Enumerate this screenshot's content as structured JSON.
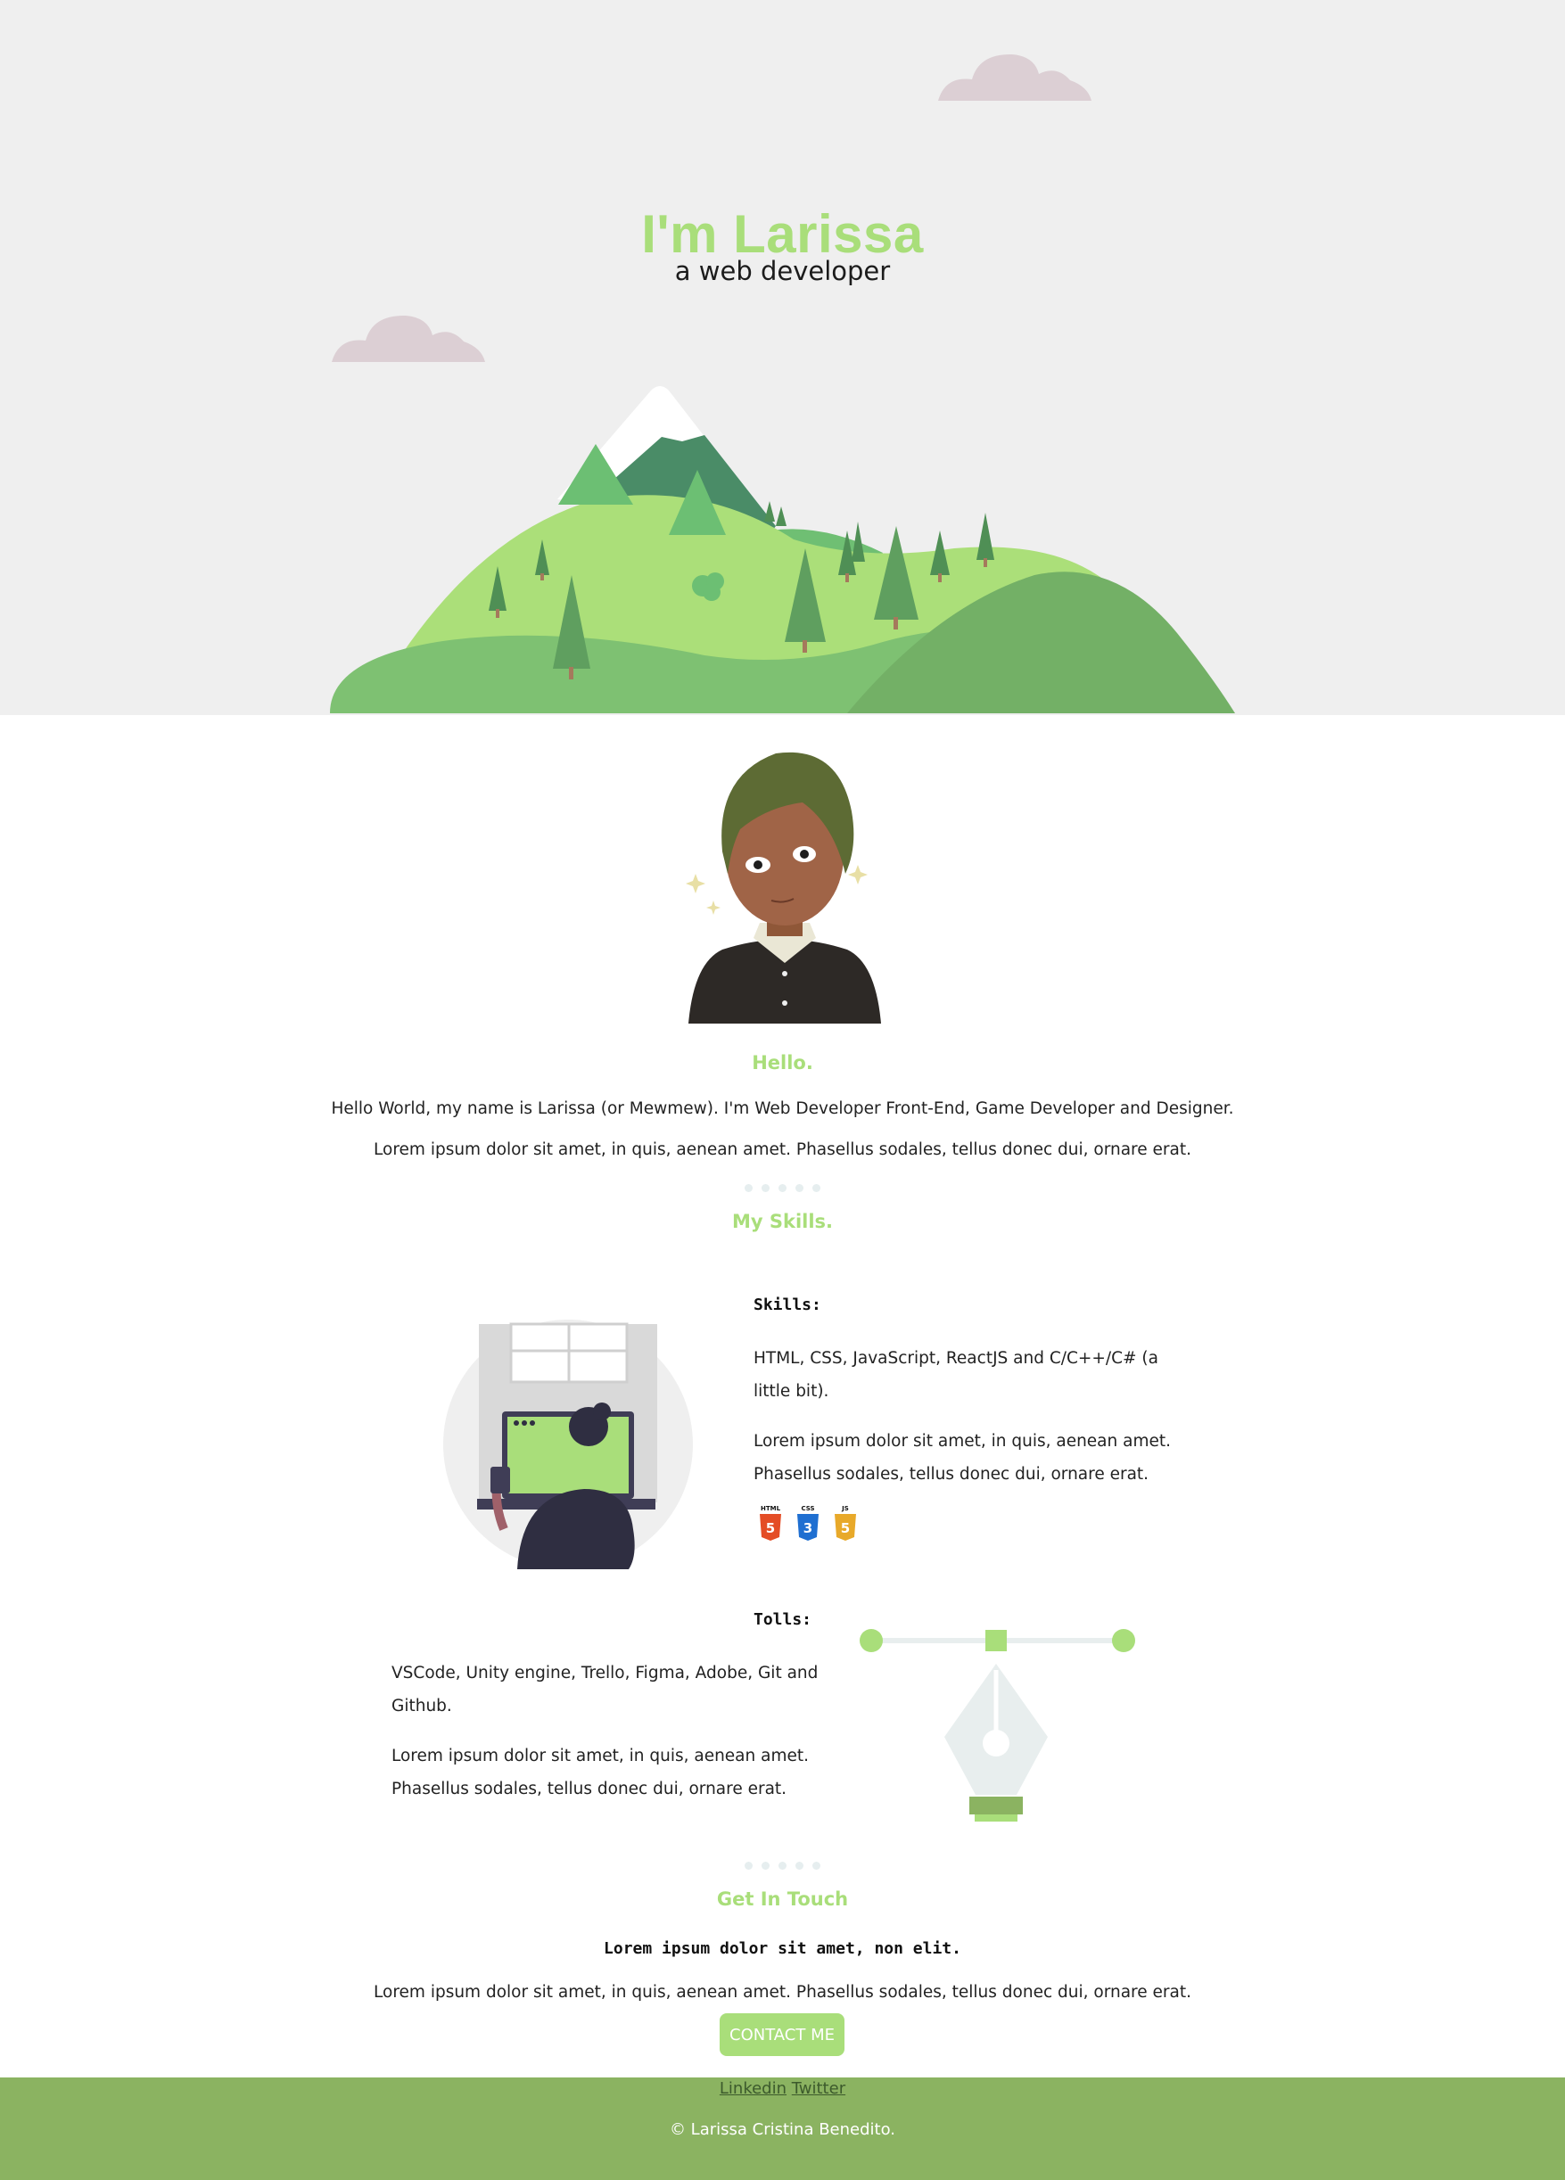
{
  "hero": {
    "title": "I'm Larissa",
    "subtitle": "a web developer"
  },
  "colors": {
    "accent": "#a9de7a",
    "hero_bg": "#efefef",
    "footer_bg": "#8bb361",
    "cloud": "#dccfd4"
  },
  "about": {
    "title": "Hello.",
    "line1": "Hello World, my name is Larissa (or Mewmew). I'm Web Developer Front-End, Game Developer and Designer.",
    "line2": "Lorem ipsum dolor sit amet, in quis, aenean amet. Phasellus sodales, tellus donec dui, ornare erat."
  },
  "skills_section": {
    "title": "My Skills.",
    "skills": {
      "heading": "Skills:",
      "line1a": "HTML, CSS, JavaScript, ReactJS and C/C++/C# (a",
      "line1b": "little bit).",
      "line2a": "Lorem ipsum dolor sit amet, in quis, aenean amet.",
      "line2b": "Phasellus sodales, tellus donec dui, ornare erat.",
      "icons": [
        {
          "label": "HTML",
          "digit": "5",
          "color": "#e44d26",
          "icon": "html5-icon"
        },
        {
          "label": "CSS",
          "digit": "3",
          "color": "#1f6fd1",
          "icon": "css3-icon"
        },
        {
          "label": "JS",
          "digit": "5",
          "color": "#e8a92a",
          "icon": "js-icon"
        }
      ]
    },
    "tools": {
      "heading": "Tolls:",
      "line1a": "VSCode, Unity engine, Trello, Figma, Adobe, Git and",
      "line1b": "Github.",
      "line2a": "Lorem ipsum dolor sit amet, in quis, aenean amet.",
      "line2b": "Phasellus sodales, tellus donec dui, ornare erat."
    }
  },
  "contact": {
    "title": "Get In Touch",
    "bold_line": "Lorem ipsum dolor sit amet, non elit.",
    "text": "Lorem ipsum dolor sit amet, in quis, aenean amet. Phasellus sodales, tellus donec dui, ornare erat.",
    "button_label": "CONTACT ME"
  },
  "footer": {
    "link_linkedin": "Linkedin",
    "link_twitter": "Twitter",
    "copyright": "© Larissa Cristina Benedito."
  }
}
